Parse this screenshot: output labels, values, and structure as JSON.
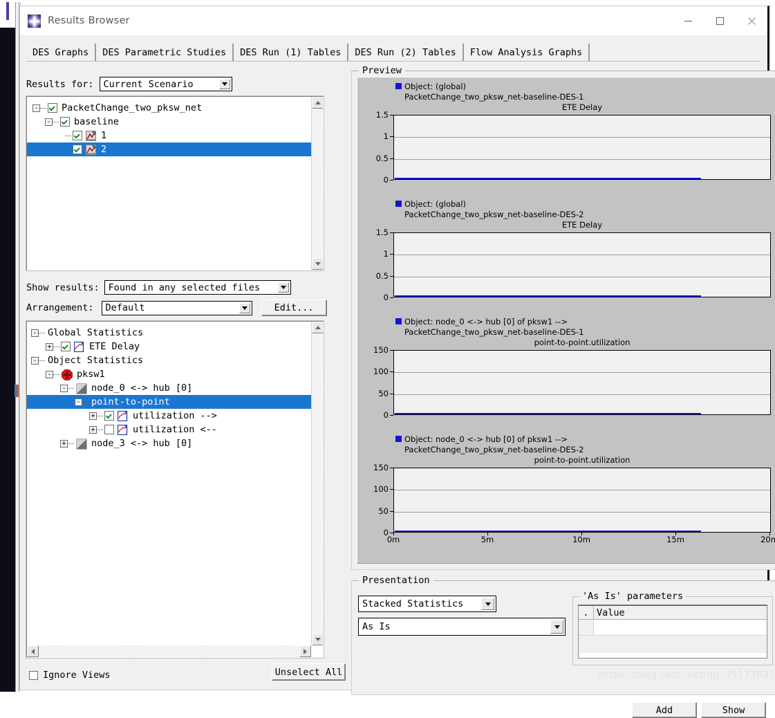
{
  "window": {
    "title": "Results Browser",
    "icon": "app-star-icon",
    "minimize": "minimize-icon",
    "maximize": "maximize-icon",
    "close": "close-icon"
  },
  "tabs": [
    {
      "label": "DES Graphs",
      "active": true
    },
    {
      "label": "DES Parametric Studies",
      "active": false
    },
    {
      "label": "DES Run (1) Tables",
      "active": false
    },
    {
      "label": "DES Run (2) Tables",
      "active": false
    },
    {
      "label": "Flow Analysis Graphs",
      "active": false
    }
  ],
  "results_for": {
    "label": "Results for:",
    "value": "Current Scenario"
  },
  "scenario_tree": [
    {
      "label": "PacketChange_two_pksw_net",
      "depth": 0,
      "expander": "-",
      "checked": true,
      "icon": null,
      "selected": false
    },
    {
      "label": "baseline",
      "depth": 1,
      "expander": "-",
      "checked": true,
      "icon": null,
      "selected": false
    },
    {
      "label": "1",
      "depth": 2,
      "expander": null,
      "checked": true,
      "icon": "des-run-icon",
      "selected": false
    },
    {
      "label": "2",
      "depth": 2,
      "expander": null,
      "checked": true,
      "icon": "des-run-icon",
      "selected": true
    }
  ],
  "show_results": {
    "label": "Show results:",
    "value": "Found in any selected files"
  },
  "arrangement": {
    "label": "Arrangement:",
    "value": "Default",
    "edit_label": "Edit..."
  },
  "stat_tree": [
    {
      "label": "Global Statistics",
      "depth": 0,
      "expander": "-",
      "checkbox": null,
      "icon": null,
      "selected": false
    },
    {
      "label": "ETE Delay",
      "depth": 1,
      "expander": "+",
      "checkbox": true,
      "icon": "statistic-graph-icon",
      "selected": false
    },
    {
      "label": "Object Statistics",
      "depth": 0,
      "expander": "-",
      "checkbox": null,
      "icon": null,
      "selected": false
    },
    {
      "label": "pksw1",
      "depth": 1,
      "expander": "-",
      "checkbox": null,
      "icon": "router-node-icon",
      "selected": false
    },
    {
      "label": "node_0 <-> hub [0]",
      "depth": 2,
      "expander": "-",
      "checkbox": null,
      "icon": "link-icon",
      "selected": false
    },
    {
      "label": "point-to-point",
      "depth": 3,
      "expander": "-",
      "checkbox": null,
      "icon": null,
      "selected": true
    },
    {
      "label": "utilization -->",
      "depth": 4,
      "expander": "+",
      "checkbox": true,
      "icon": "statistic-graph-icon",
      "selected": false
    },
    {
      "label": "utilization <--",
      "depth": 4,
      "expander": "+",
      "checkbox": false,
      "icon": "statistic-graph-icon",
      "selected": false
    },
    {
      "label": "node_3 <-> hub [0]",
      "depth": 2,
      "expander": "+",
      "checkbox": null,
      "icon": "link-icon",
      "selected": false
    }
  ],
  "bottom_left": {
    "ignore_views_label": "Ignore Views",
    "ignore_views_checked": false,
    "unselect_all_label": "Unselect All"
  },
  "preview": {
    "title": "Preview"
  },
  "presentation": {
    "title": "Presentation",
    "mode_value": "Stacked Statistics",
    "filter_value": "As Is",
    "params_title": "'As Is' parameters",
    "params_col_1": ".",
    "params_col_2": "Value",
    "params_rows": [
      {
        "c1": "",
        "c2": ""
      }
    ],
    "add_label": "Add",
    "show_label": "Show"
  },
  "watermark": "https://blog.csdn.net/qq_35173631",
  "chart_data": [
    {
      "type": "line",
      "legend_object": "Object: (global)",
      "subtitle": "PacketChange_two_pksw_net-baseline-DES-1",
      "title": "ETE Delay",
      "series_color": "#1414d6",
      "yticks": [
        0,
        0.5,
        1,
        1.5
      ],
      "ylim": [
        0,
        1.5
      ],
      "xlim": [
        0,
        20
      ],
      "xticks": [],
      "xticklabels": [],
      "x": [
        0,
        16.3
      ],
      "y": [
        0,
        0
      ],
      "grid": true
    },
    {
      "type": "line",
      "legend_object": "Object: (global)",
      "subtitle": "PacketChange_two_pksw_net-baseline-DES-2",
      "title": "ETE Delay",
      "series_color": "#1414d6",
      "yticks": [
        0,
        0.5,
        1,
        1.5
      ],
      "ylim": [
        0,
        1.5
      ],
      "xlim": [
        0,
        20
      ],
      "xticks": [],
      "xticklabels": [],
      "x": [
        0,
        16.3
      ],
      "y": [
        0,
        0
      ],
      "grid": true
    },
    {
      "type": "line",
      "legend_object": "Object: node_0 <-> hub [0] of pksw1 -->",
      "subtitle": "PacketChange_two_pksw_net-baseline-DES-1",
      "title": "point-to-point.utilization",
      "series_color": "#1414d6",
      "yticks": [
        0,
        50,
        100,
        150
      ],
      "ylim": [
        0,
        150
      ],
      "xlim": [
        0,
        20
      ],
      "xticks": [],
      "xticklabels": [],
      "x": [
        0,
        16.3
      ],
      "y": [
        0,
        0
      ],
      "grid": true
    },
    {
      "type": "line",
      "legend_object": "Object: node_0 <-> hub [0] of pksw1 -->",
      "subtitle": "PacketChange_two_pksw_net-baseline-DES-2",
      "title": "point-to-point.utilization",
      "series_color": "#1414d6",
      "yticks": [
        0,
        50,
        100,
        150
      ],
      "ylim": [
        0,
        150
      ],
      "xlim": [
        0,
        20
      ],
      "xticks": [
        0,
        5,
        10,
        15,
        20
      ],
      "xticklabels": [
        "0m",
        "5m",
        "10m",
        "15m",
        "20m"
      ],
      "x": [
        0,
        16.3
      ],
      "y": [
        0,
        0
      ],
      "grid": true,
      "xlabel": ""
    }
  ]
}
